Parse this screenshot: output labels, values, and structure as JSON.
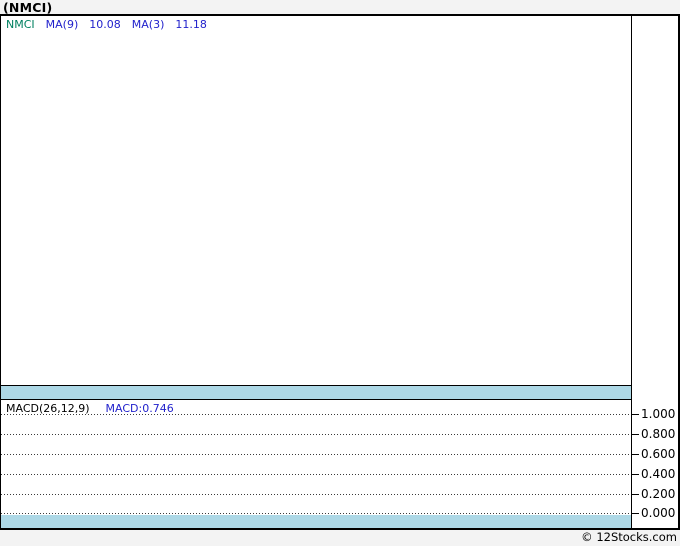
{
  "page": {
    "title": "(NMCI)",
    "footer_credit": "© 12Stocks.com"
  },
  "price_panel": {
    "legend": {
      "symbol": "NMCI",
      "ma1_label": "MA(9)",
      "ma1_value": "10.08",
      "ma2_label": "MA(3)",
      "ma2_value": "11.18"
    }
  },
  "macd_panel": {
    "indicator_label": "MACD(26,12,9)",
    "indicator_value": "MACD:0.746",
    "ticks": [
      "1.000",
      "0.800",
      "0.600",
      "0.400",
      "0.200",
      "0.000"
    ]
  },
  "colors": {
    "symbol_green": "#008060",
    "indicator_blue": "#2222cc",
    "band_lightblue": "#add8e6",
    "page_background": "#f3f3f3",
    "plot_background": "#ffffff",
    "border_black": "#000000"
  },
  "chart_data": [
    {
      "type": "line",
      "title": "NMCI price panel with moving averages",
      "series": [
        {
          "name": "NMCI",
          "color": "#008060",
          "values": []
        },
        {
          "name": "MA(9)",
          "color": "#2222cc",
          "last_value": 10.08,
          "values": []
        },
        {
          "name": "MA(3)",
          "color": "#2222cc",
          "last_value": 11.18,
          "values": []
        }
      ],
      "legend_position": "top-left",
      "grid": false,
      "note": "plot area is rendered empty; no visible price or MA lines"
    },
    {
      "type": "line",
      "title": "MACD(26,12,9)",
      "series": [
        {
          "name": "MACD",
          "color": "#2222cc",
          "last_value": 0.746,
          "values": []
        }
      ],
      "ylim": [
        0.0,
        1.0
      ],
      "yticks": [
        1.0,
        0.8,
        0.6,
        0.4,
        0.2,
        0.0
      ],
      "y_axis_side": "right",
      "grid": "horizontal dotted",
      "legend_position": "top-left",
      "note": "plot area is rendered empty; no visible MACD line or histogram"
    }
  ]
}
